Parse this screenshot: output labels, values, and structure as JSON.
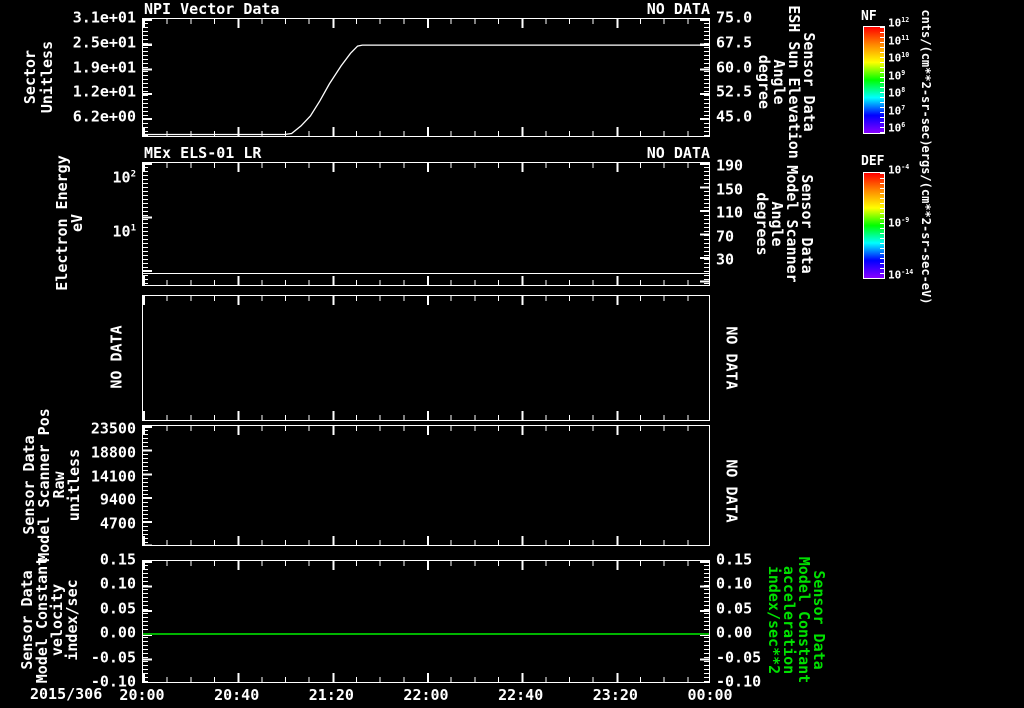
{
  "figure": {
    "background": "#000000",
    "foreground": "#ffffff",
    "green_text": "#00e000",
    "green_line": "#00b400"
  },
  "x_axis": {
    "date_label": "2015/306",
    "tick_labels": [
      "20:00",
      "20:40",
      "21:20",
      "22:00",
      "22:40",
      "23:20",
      "00:00"
    ],
    "range": "20:00 to 00:00 (240 minutes)"
  },
  "panels": [
    {
      "title": "NPI Vector Data",
      "status": "NO DATA",
      "left_axis": {
        "label_lines": [
          "Sector",
          "Unitless"
        ],
        "ticks": [
          "3.1e+01",
          "2.5e+01",
          "1.9e+01",
          "1.2e+01",
          "6.2e+00"
        ]
      },
      "right_axis": {
        "label_lines": [
          "Sensor Data",
          "ESH Sun Elevation",
          "Angle",
          "degree"
        ],
        "ticks": [
          "75.0",
          "67.5",
          "60.0",
          "52.5",
          "45.0"
        ]
      }
    },
    {
      "title": "MEx ELS-01 LR",
      "status": "NO DATA",
      "left_axis": {
        "label_lines": [
          "Electron Energy",
          "eV"
        ],
        "ticks": [
          {
            "base": "10",
            "exp": "2"
          },
          {
            "base": "10",
            "exp": "1"
          }
        ]
      },
      "right_axis": {
        "label_lines": [
          "Sensor Data",
          "Model Scanner",
          "Angle",
          "degrees"
        ],
        "ticks": [
          "190",
          "150",
          "110",
          "70",
          "30"
        ]
      }
    },
    {
      "left_text": "NO DATA",
      "right_text": "NO DATA"
    },
    {
      "left_axis": {
        "label_lines": [
          "Sensor Data",
          "Model Scanner Pos",
          "Raw",
          "unitless"
        ],
        "ticks": [
          "23500",
          "18800",
          "14100",
          "9400",
          "4700"
        ]
      },
      "right_text": "NO DATA"
    },
    {
      "left_axis": {
        "label_lines": [
          "Sensor Data",
          "Model Constant",
          "velocity",
          "index/sec"
        ],
        "ticks": [
          "0.15",
          "0.10",
          "0.05",
          "0.00",
          "-0.05",
          "-0.10"
        ]
      },
      "right_axis": {
        "label_lines": [
          "Sensor Data",
          "Model Constant",
          "acceleration",
          "index/sec**2"
        ],
        "ticks": [
          "0.15",
          "0.10",
          "0.05",
          "0.00",
          "-0.05",
          "-0.10"
        ]
      }
    }
  ],
  "colorbars": [
    {
      "title": "NF",
      "unit": "cnts/(cm**2-sr-sec)",
      "ticks": [
        {
          "base": "10",
          "exp": "12"
        },
        {
          "base": "10",
          "exp": "11"
        },
        {
          "base": "10",
          "exp": "10"
        },
        {
          "base": "10",
          "exp": "9"
        },
        {
          "base": "10",
          "exp": "8"
        },
        {
          "base": "10",
          "exp": "7"
        },
        {
          "base": "10",
          "exp": "6"
        }
      ],
      "colors": [
        "#ff0000",
        "#ff8800",
        "#ffff00",
        "#00ff00",
        "#00ffff",
        "#0000ff",
        "#8800ff"
      ]
    },
    {
      "title": "DEF",
      "unit": "ergs/(cm**2-sr-sec-eV)",
      "ticks": [
        {
          "base": "10",
          "exp": "-4"
        },
        {
          "base": "10",
          "exp": "-9"
        },
        {
          "base": "10",
          "exp": "-14"
        }
      ],
      "colors": [
        "#ff0000",
        "#ff8800",
        "#ffff00",
        "#00ff00",
        "#00ffff",
        "#0000ff",
        "#8800ff"
      ]
    }
  ],
  "chart_data": [
    {
      "panel": 1,
      "type": "line",
      "title": "NPI Vector Data",
      "status": "NO DATA",
      "ylabel_left": "Sector Unitless",
      "ylabel_right": "Sensor Data ESH Sun Elevation Angle degree",
      "ylim_left": [
        1.4,
        31.0
      ],
      "ylim_right": [
        39.2,
        75.0
      ],
      "series": [
        {
          "name": "ESH Sun Elevation Angle (degree, right axis)",
          "x_minutes": [
            0,
            60,
            63,
            67,
            71,
            75,
            79,
            84,
            88,
            91,
            93,
            240
          ],
          "y_degrees": [
            40.0,
            40.0,
            40.3,
            42.6,
            45.6,
            50.2,
            55.3,
            60.8,
            64.6,
            66.8,
            67.1,
            67.1
          ]
        }
      ]
    },
    {
      "panel": 2,
      "type": "line",
      "title": "MEx ELS-01 LR",
      "status": "NO DATA",
      "ylabel_left": "Electron Energy eV (log scale)",
      "ylabel_right": "Sensor Data Model Scanner Angle degrees",
      "ylim_left_log": [
        1.5,
        200
      ],
      "ylim_right": [
        10,
        195
      ],
      "series": [
        {
          "name": "constant trace near bottom",
          "value_eV": 1.7
        }
      ]
    },
    {
      "panel": 3,
      "type": "none",
      "status": "NO DATA"
    },
    {
      "panel": 4,
      "type": "none",
      "status": "NO DATA",
      "ylabel_left": "Sensor Data Model Scanner Pos Raw unitless",
      "ylim_left": [
        0,
        23500
      ]
    },
    {
      "panel": 5,
      "type": "line",
      "ylabel_left": "Sensor Data Model Constant velocity index/sec",
      "ylabel_right": "Sensor Data Model Constant acceleration index/sec**2",
      "ylim": [
        -0.1,
        0.15
      ],
      "series": [
        {
          "name": "constant acceleration/velocity line",
          "value": 0.0,
          "color": "#00b400"
        }
      ]
    }
  ]
}
